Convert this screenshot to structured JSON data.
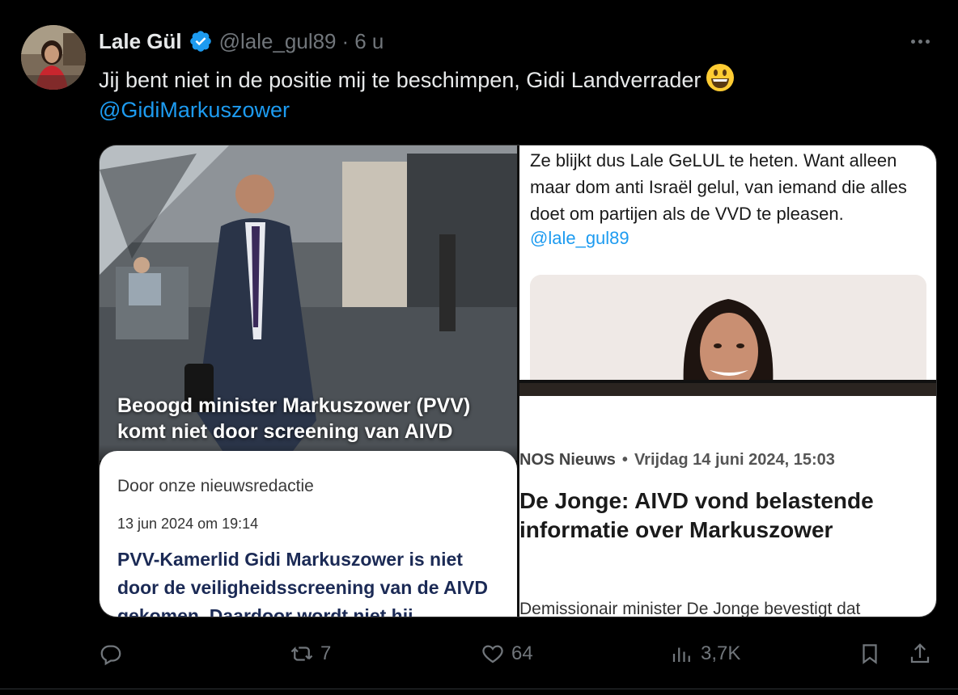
{
  "tweet": {
    "author_name": "Lale Gül",
    "handle": "@lale_gul89",
    "separator": "·",
    "time": "6 u",
    "text": "Jij bent niet in de positie mij te beschimpen, Gidi Landverrader",
    "emoji": "grinning-face",
    "mention": "@GidiMarkuszower"
  },
  "media": {
    "left": {
      "overlay_headline": "Beoogd minister Markuszower (PVV) komt niet door screening van AIVD",
      "byline": "Door onze nieuwsredactie",
      "date": "13 jun 2024 om 19:14",
      "lead": "PVV-Kamerlid Gidi Markuszower is niet door de veiligheidsscreening van de AIVD gekomen. Daardoor wordt niet hij"
    },
    "right_top": {
      "quote": "Ze blijkt dus Lale GeLUL te heten. Want alleen maar dom anti Israël gelul, van iemand die alles doet om partijen als de VVD te pleasen.",
      "handle": "@lale_gul89"
    },
    "right_bottom": {
      "source": "NOS Nieuws",
      "bullet": "•",
      "date": "Vrijdag 14 juni 2024, 15:03",
      "title": "De Jonge: AIVD vond belastende informatie over Markuszower",
      "body": "Demissionair minister De Jonge bevestigt dat"
    }
  },
  "actions": {
    "reply_count": "",
    "retweet_count": "7",
    "like_count": "64",
    "views_count": "3,7K"
  },
  "colors": {
    "background": "#000000",
    "text": "#e7e9ea",
    "muted": "#71767b",
    "link": "#1d9bf0",
    "verified": "#1d9bf0"
  }
}
